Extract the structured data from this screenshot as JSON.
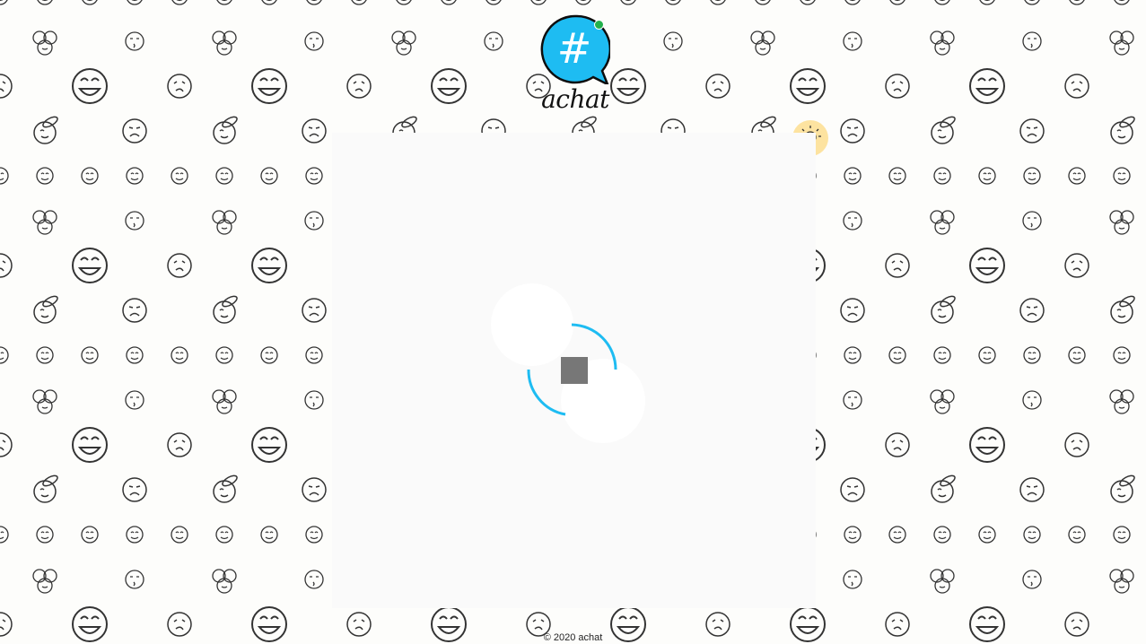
{
  "app": {
    "logo_symbol": "#",
    "logo_word": "achat",
    "logo_color": "#1ebcf2",
    "online_indicator_color": "#22b14c"
  },
  "hint": {
    "icon": "lightbulb-icon",
    "background": "#fde3a0"
  },
  "loader": {
    "state": "loading",
    "accent": "#1ebcf2"
  },
  "footer": {
    "copyright": "© 2020 achat"
  }
}
